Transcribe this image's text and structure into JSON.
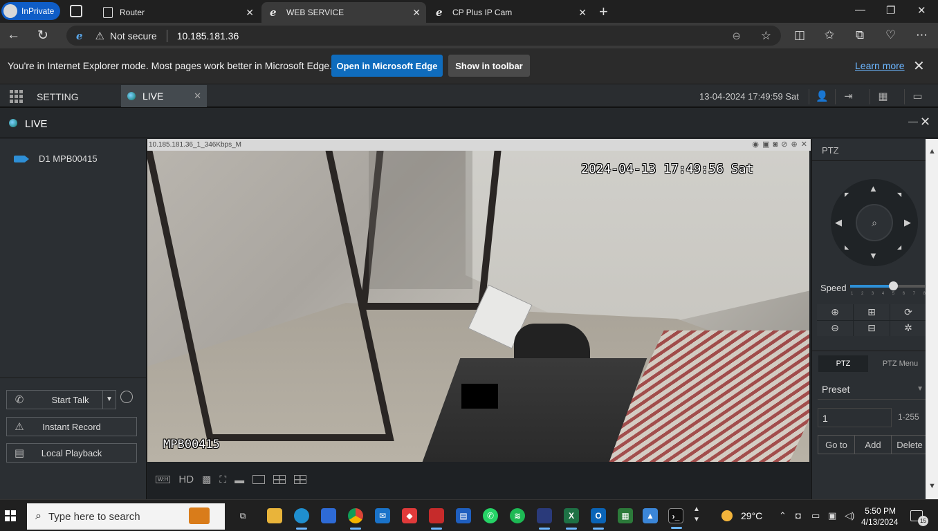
{
  "browser": {
    "inprivate_label": "InPrivate",
    "tabs": [
      {
        "title": "Router",
        "active": false
      },
      {
        "title": "WEB SERVICE",
        "active": true
      },
      {
        "title": "CP Plus IP Cam",
        "active": false
      }
    ],
    "new_tab": "+",
    "window_controls": {
      "minimize": "—",
      "restore": "❐",
      "close": "✕"
    }
  },
  "address_bar": {
    "security": "Not secure",
    "url": "10.185.181.36"
  },
  "ie_mode_bar": {
    "message": "You're in Internet Explorer mode. Most pages work better in Microsoft Edge.",
    "open_button": "Open in Microsoft Edge",
    "toolbar_button": "Show in toolbar",
    "learn_more": "Learn more"
  },
  "app_header": {
    "setting_label": "SETTING",
    "live_tab": "LIVE",
    "datetime": "13-04-2024 17:49:59 Sat"
  },
  "live_window": {
    "title": "LIVE",
    "devices": [
      {
        "label": "D1 MPB00415"
      }
    ],
    "buttons": {
      "talk": "Start Talk",
      "record": "Instant Record",
      "playback": "Local Playback"
    }
  },
  "video": {
    "stream_label": "10.185.181.36_1_346Kbps_M",
    "osd_timestamp": "2024-04-13 17:49:56 Sat",
    "osd_name": "MPB00415",
    "toolbar": {
      "wh": "W:H",
      "hd": "HD"
    }
  },
  "ptz": {
    "title": "PTZ",
    "speed_label": "Speed",
    "speed_value": 5,
    "speed_ticks": [
      "1",
      "2",
      "3",
      "4",
      "5",
      "6",
      "7",
      "8"
    ],
    "tabs": {
      "ptz": "PTZ",
      "menu": "PTZ Menu"
    },
    "preset_label": "Preset",
    "preset_value": "1",
    "preset_range": "1-255",
    "actions": {
      "goto": "Go to",
      "add": "Add",
      "delete": "Delete"
    }
  },
  "taskbar": {
    "search_placeholder": "Type here to search",
    "weather": "29°C",
    "time": "5:50 PM",
    "date": "4/13/2024",
    "notifications": "15"
  }
}
